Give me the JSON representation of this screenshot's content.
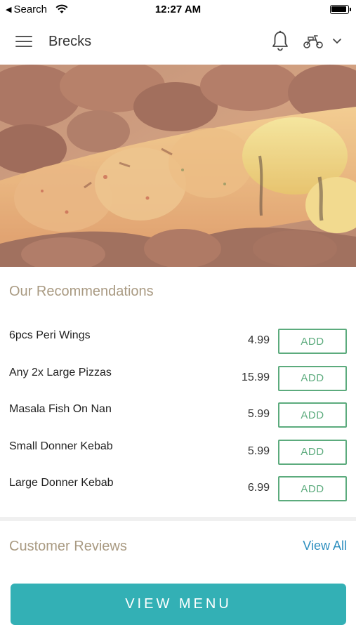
{
  "status_bar": {
    "back_label": "Search",
    "time": "12:27 AM"
  },
  "header": {
    "title": "Brecks",
    "icons": [
      "menu-icon",
      "bell-icon",
      "scooter-icon",
      "chevron-down-icon"
    ]
  },
  "hero": {
    "image": "grilled-kebab-skewers-photo"
  },
  "recommendations": {
    "title": "Our Recommendations",
    "items": [
      {
        "name": "6pcs Peri Wings",
        "price": "4.99",
        "action": "ADD"
      },
      {
        "name": "Any 2x Large Pizzas",
        "price": "15.99",
        "action": "ADD"
      },
      {
        "name": "Masala Fish On Nan",
        "price": "5.99",
        "action": "ADD"
      },
      {
        "name": "Small Donner Kebab",
        "price": "5.99",
        "action": "ADD"
      },
      {
        "name": "Large Donner Kebab",
        "price": "6.99",
        "action": "ADD"
      }
    ]
  },
  "reviews": {
    "title": "Customer Reviews",
    "view_all": "View All"
  },
  "footer": {
    "view_menu": "VIEW MENU"
  },
  "colors": {
    "accent_teal": "#33b0b5",
    "add_green": "#5cab7d",
    "section_title": "#a99a82",
    "link_blue": "#2e8fbf"
  }
}
